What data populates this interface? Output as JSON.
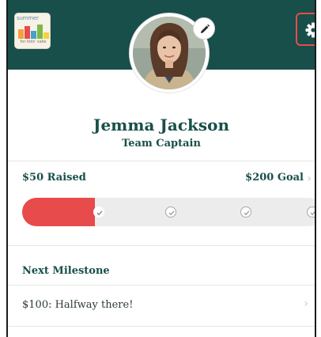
{
  "header": {
    "bg_color": "#184f4a",
    "logo": {
      "text": "summer",
      "subtext": "for kids' sake",
      "icon": "summer-logo-icon"
    },
    "settings_icon": "gear-icon",
    "accent_color": "#e84b4b"
  },
  "profile": {
    "name": "Jemma Jackson",
    "role": "Team Captain",
    "edit_icon": "pencil-icon",
    "avatar": "avatar-photo"
  },
  "progress": {
    "raised_label": "$50 Raised",
    "goal_label": "$200 Goal",
    "raised": 50,
    "goal": 200,
    "fraction": 0.25,
    "fill_color": "#e84b4b",
    "milestones_complete": 1,
    "milestones_total": 4,
    "check_icon": "checkmark-icon"
  },
  "milestone": {
    "title": "Next Milestone",
    "item": "$100: Halfway there!",
    "chevron_icon": "chevron-right-icon"
  }
}
